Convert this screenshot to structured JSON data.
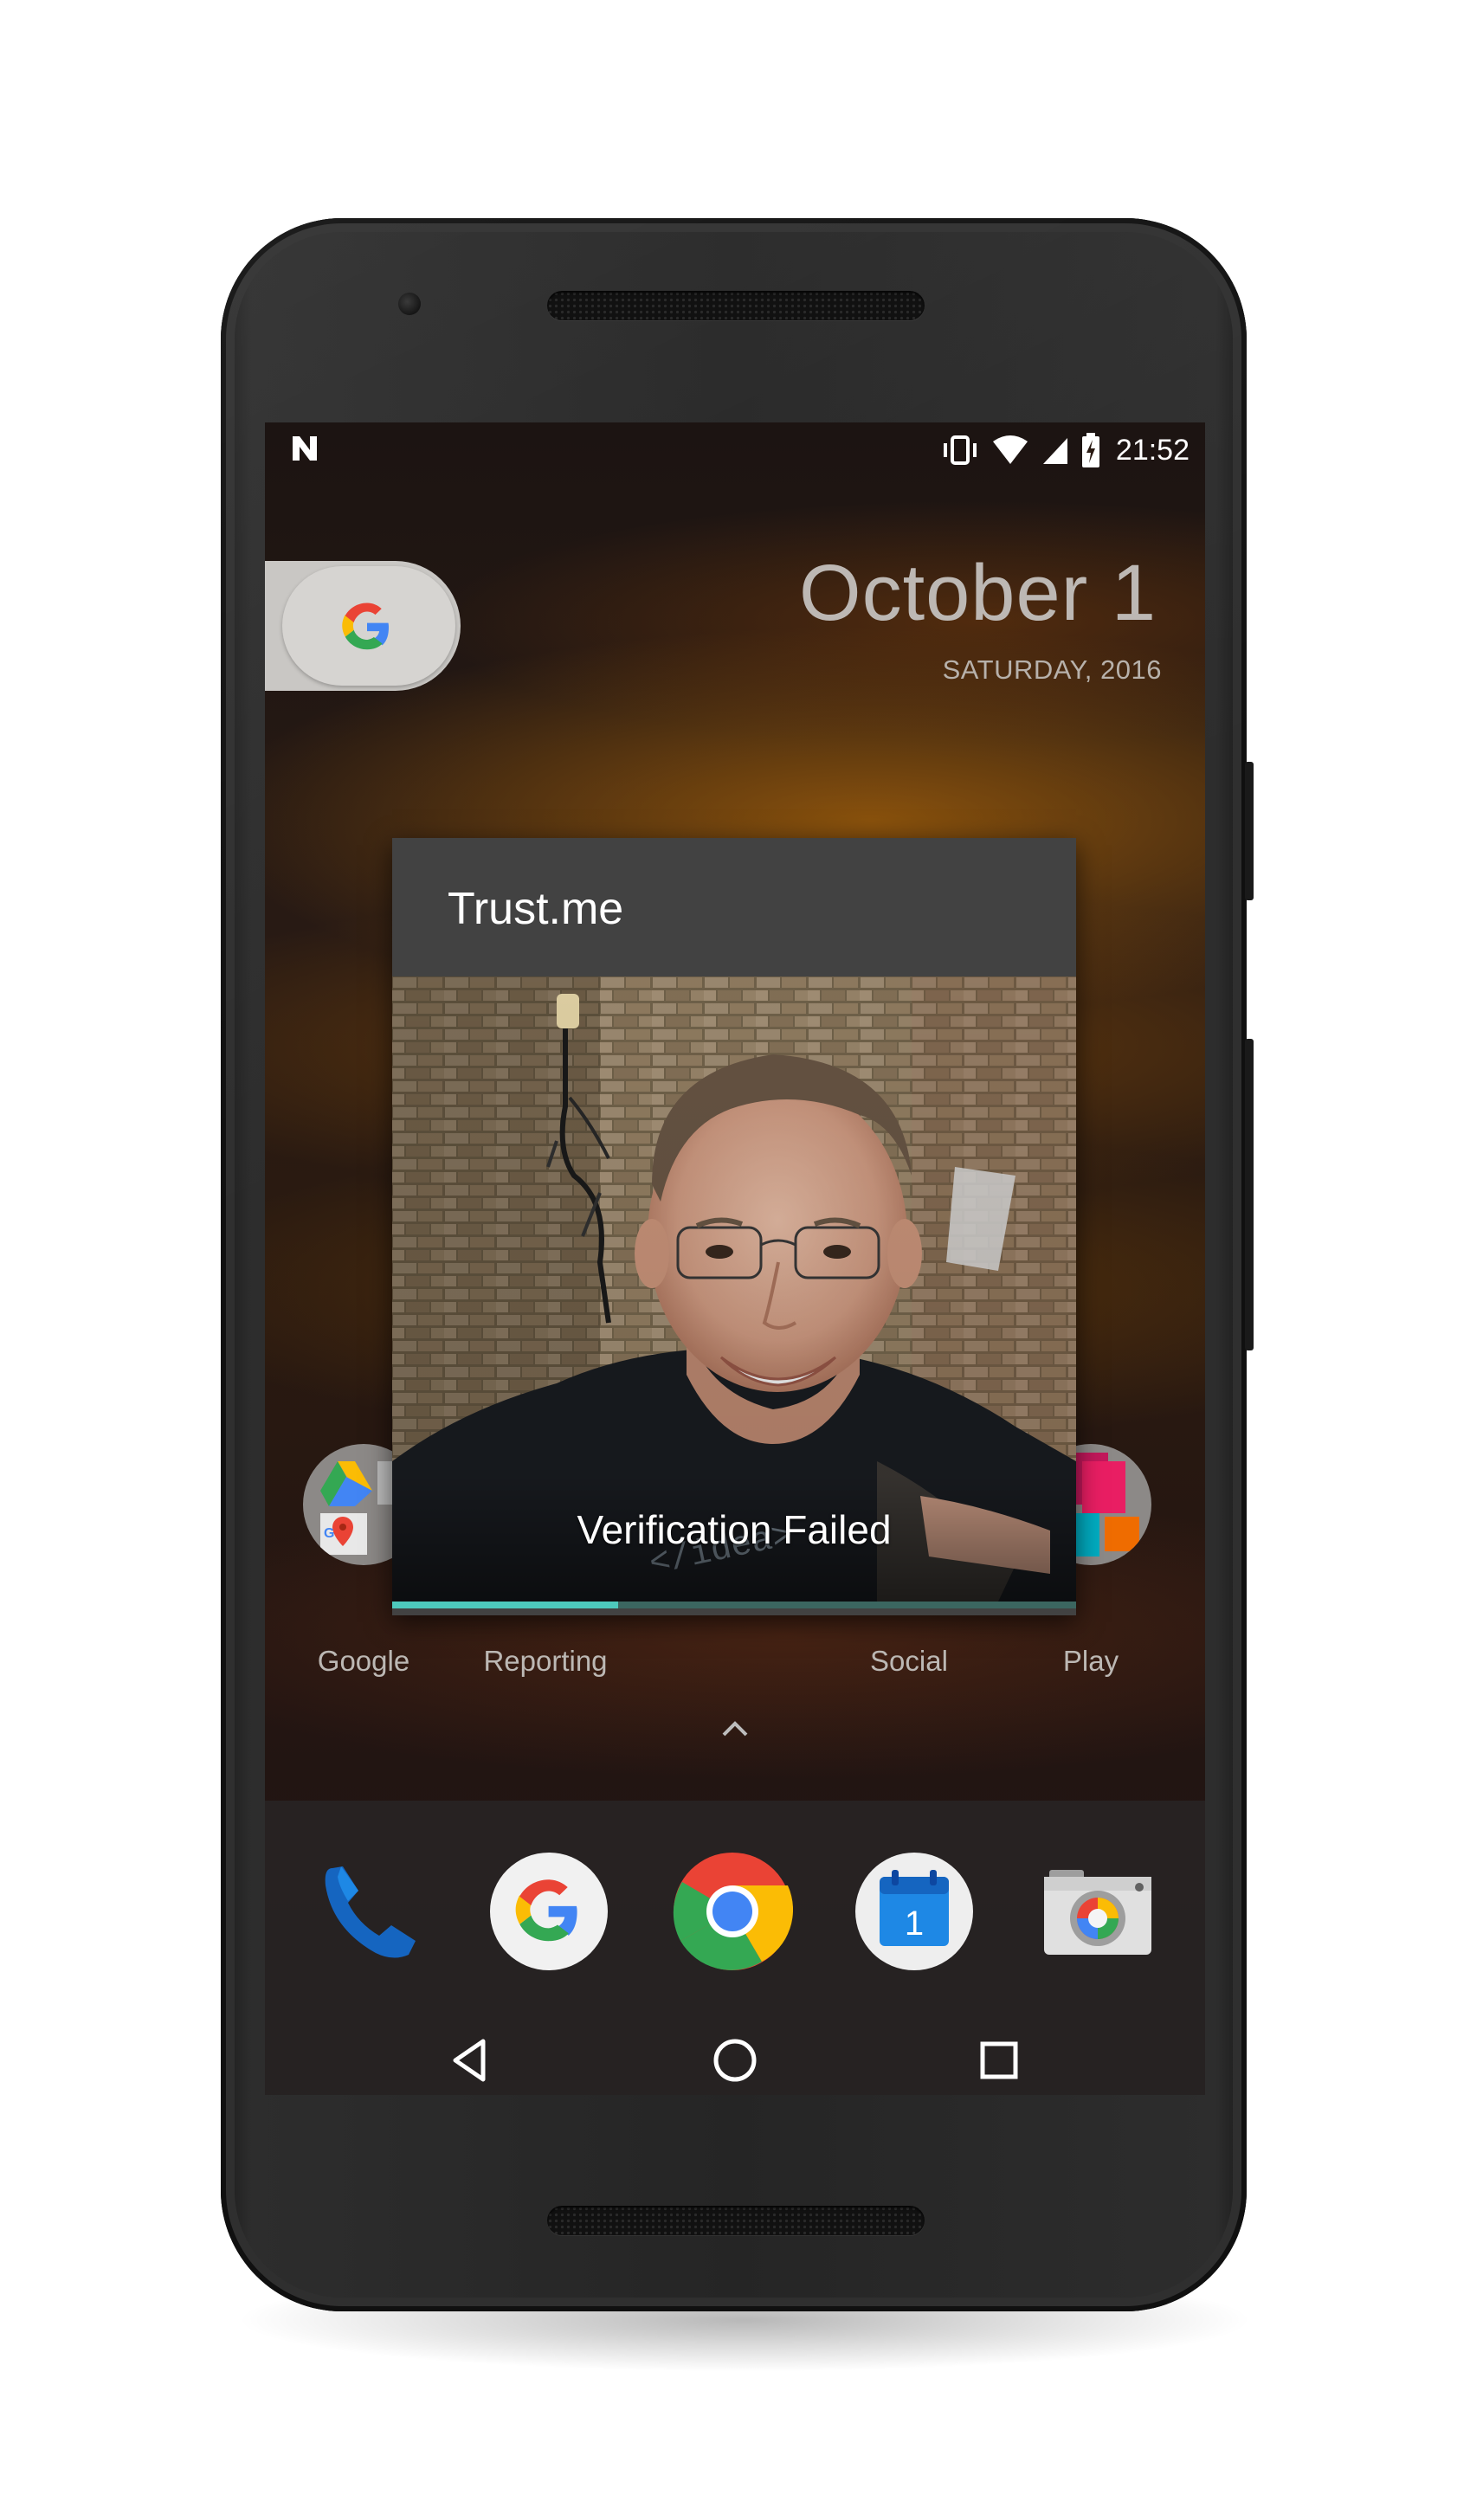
{
  "status_bar": {
    "time": "21:52",
    "icons": [
      "notification-n-icon",
      "vibrate-icon",
      "wifi-icon",
      "cell-signal-icon",
      "battery-charging-icon"
    ]
  },
  "home": {
    "date": "October 1",
    "day_year": "SATURDAY, 2016",
    "folders": [
      {
        "label": "Google"
      },
      {
        "label": "Reporting"
      },
      {
        "label": "Social"
      },
      {
        "label": "Play"
      }
    ],
    "dock": [
      "phone-icon",
      "google-app-icon",
      "chrome-icon",
      "calendar-icon",
      "camera-icon"
    ],
    "calendar_day": "1"
  },
  "dialog": {
    "title": "Trust.me",
    "status": "Verification Failed",
    "progress": 0.33
  },
  "colors": {
    "dialog_bg": "#424242",
    "accent": "#4dc9bc",
    "google_blue": "#4285F4",
    "google_red": "#EA4335",
    "google_yellow": "#FBBC05",
    "google_green": "#34A853"
  }
}
